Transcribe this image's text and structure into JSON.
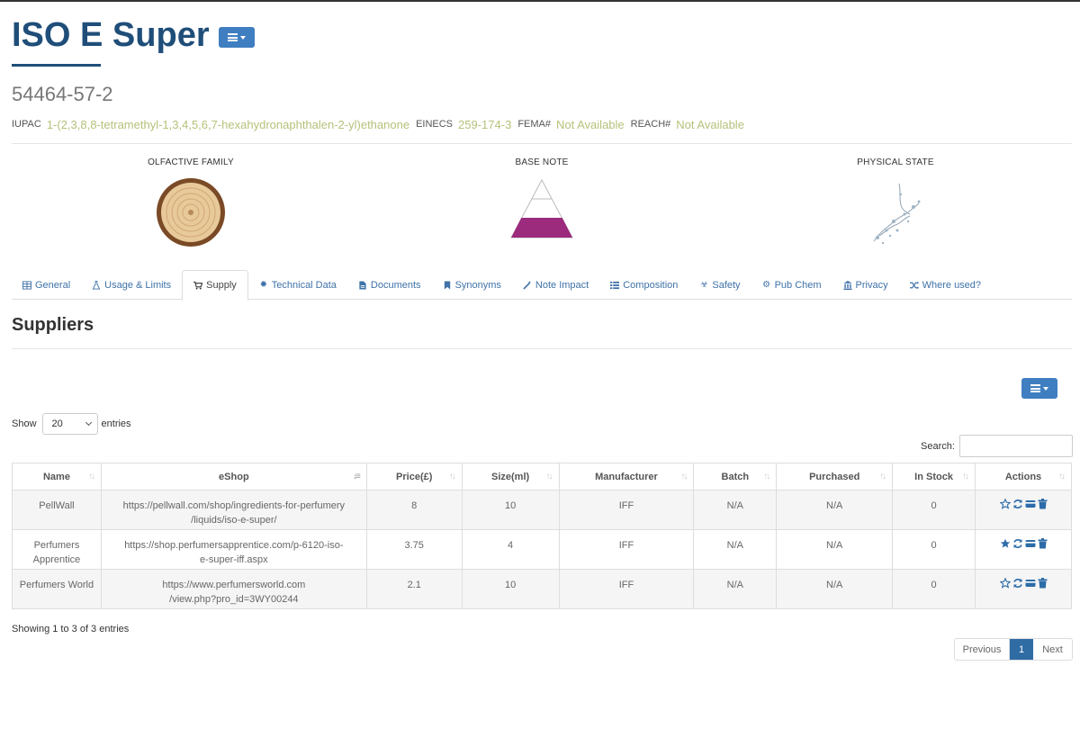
{
  "page": {
    "title": "ISO E Super",
    "cas": "54464-57-2"
  },
  "identifiers": {
    "iupac_label": "IUPAC",
    "iupac_value": "1-(2,3,8,8-tetramethyl-1,3,4,5,6,7-hexahydronaphthalen-2-yl)ethanone",
    "einecs_label": "EINECS",
    "einecs_value": "259-174-3",
    "fema_label": "FEMA#",
    "fema_value": "Not Available",
    "reach_label": "REACH#",
    "reach_value": "Not Available"
  },
  "features": {
    "olfactive_family": "OLFACTIVE FAMILY",
    "note": "BASE NOTE",
    "physical_state": "PHYSICAL STATE"
  },
  "tabs": [
    {
      "label": "General",
      "icon": "table-icon"
    },
    {
      "label": "Usage & Limits",
      "icon": "flask-icon"
    },
    {
      "label": "Supply",
      "icon": "cart-icon"
    },
    {
      "label": "Technical Data",
      "icon": "cog-icon"
    },
    {
      "label": "Documents",
      "icon": "file-icon"
    },
    {
      "label": "Synonyms",
      "icon": "bookmark-icon"
    },
    {
      "label": "Note Impact",
      "icon": "magic-wand-icon"
    },
    {
      "label": "Composition",
      "icon": "list-icon"
    },
    {
      "label": "Safety",
      "icon": "biohazard-icon"
    },
    {
      "label": "Pub Chem",
      "icon": "gear-icon"
    },
    {
      "label": "Privacy",
      "icon": "building-icon"
    },
    {
      "label": "Where used?",
      "icon": "shuffle-icon"
    }
  ],
  "active_tab": "Supply",
  "section_title": "Suppliers",
  "table_controls": {
    "show_label": "Show",
    "entries_value": "20",
    "entries_label": "entries",
    "search_label": "Search:",
    "search_value": ""
  },
  "table": {
    "columns": [
      "Name",
      "eShop",
      "Price(£)",
      "Size(ml)",
      "Manufacturer",
      "Batch",
      "Purchased",
      "In Stock",
      "Actions"
    ],
    "rows": [
      {
        "name": "PellWall",
        "eshop": "https://pellwall.com/shop/ingredients-for-perfumery/liquids/iso-e-super/",
        "eshop_l1": "https://pellwall.com/shop/ingredients-for-perfumery",
        "eshop_l2": "/liquids/iso-e-super/",
        "price": "8",
        "size": "10",
        "manufacturer": "IFF",
        "batch": "N/A",
        "purchased": "N/A",
        "stock": "0",
        "preferred": false
      },
      {
        "name": "Perfumers Apprentice",
        "name_l1": "Perfumers",
        "name_l2": "Apprentice",
        "eshop": "https://shop.perfumersapprentice.com/p-6120-iso-e-super-iff.aspx",
        "eshop_l1": "https://shop.perfumersapprentice.com/p-6120-iso-",
        "eshop_l2": "e-super-iff.aspx",
        "price": "3.75",
        "size": "4",
        "manufacturer": "IFF",
        "batch": "N/A",
        "purchased": "N/A",
        "stock": "0",
        "preferred": true
      },
      {
        "name": "Perfumers World",
        "eshop": "https://www.perfumersworld.com/view.php?pro_id=3WY00244",
        "eshop_l1": "https://www.perfumersworld.com",
        "eshop_l2": "/view.php?pro_id=3WY00244",
        "price": "2.1",
        "size": "10",
        "manufacturer": "IFF",
        "batch": "N/A",
        "purchased": "N/A",
        "stock": "0",
        "preferred": false
      }
    ]
  },
  "footer": {
    "info": "Showing 1 to 3 of 3 entries",
    "previous": "Previous",
    "current_page": "1",
    "next": "Next"
  },
  "colors": {
    "title": "#1f4e79",
    "accent": "#3f7ec0",
    "id_value": "#b5c27a",
    "link": "#3f72a8",
    "base_note": "#9c2a7d"
  }
}
